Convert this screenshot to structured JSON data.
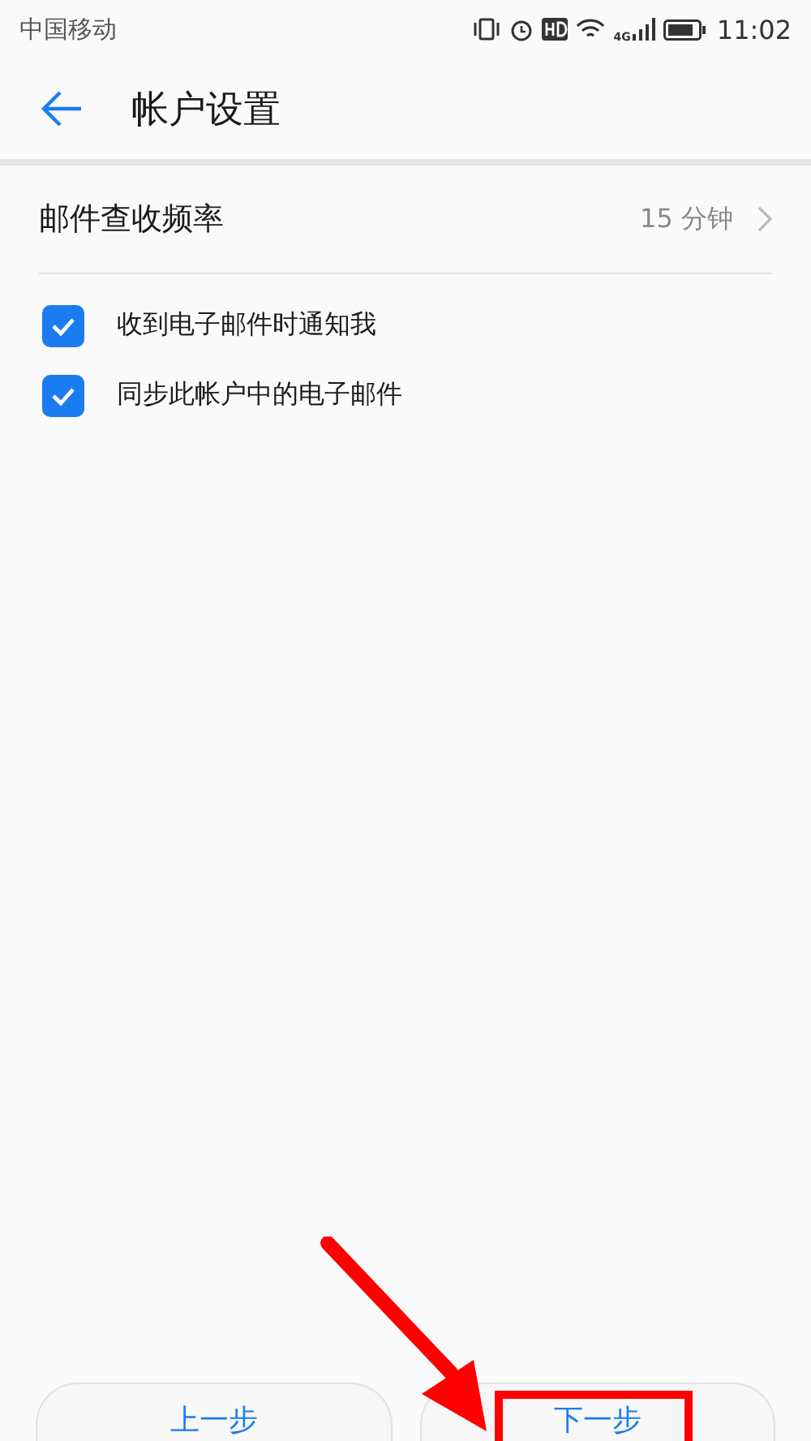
{
  "status_bar": {
    "carrier": "中国移动",
    "network": "4G",
    "time": "11:02"
  },
  "header": {
    "title": "帐户设置"
  },
  "frequency_row": {
    "label": "邮件查收频率",
    "value": "15 分钟"
  },
  "options": [
    {
      "label": "收到电子邮件时通知我",
      "checked": true
    },
    {
      "label": "同步此帐户中的电子邮件",
      "checked": true
    }
  ],
  "buttons": [
    {
      "label": "上一步",
      "highlighted": false
    },
    {
      "label": "下一步",
      "highlighted": true
    }
  ],
  "annotations": [
    {
      "kind": "arrow"
    }
  ]
}
